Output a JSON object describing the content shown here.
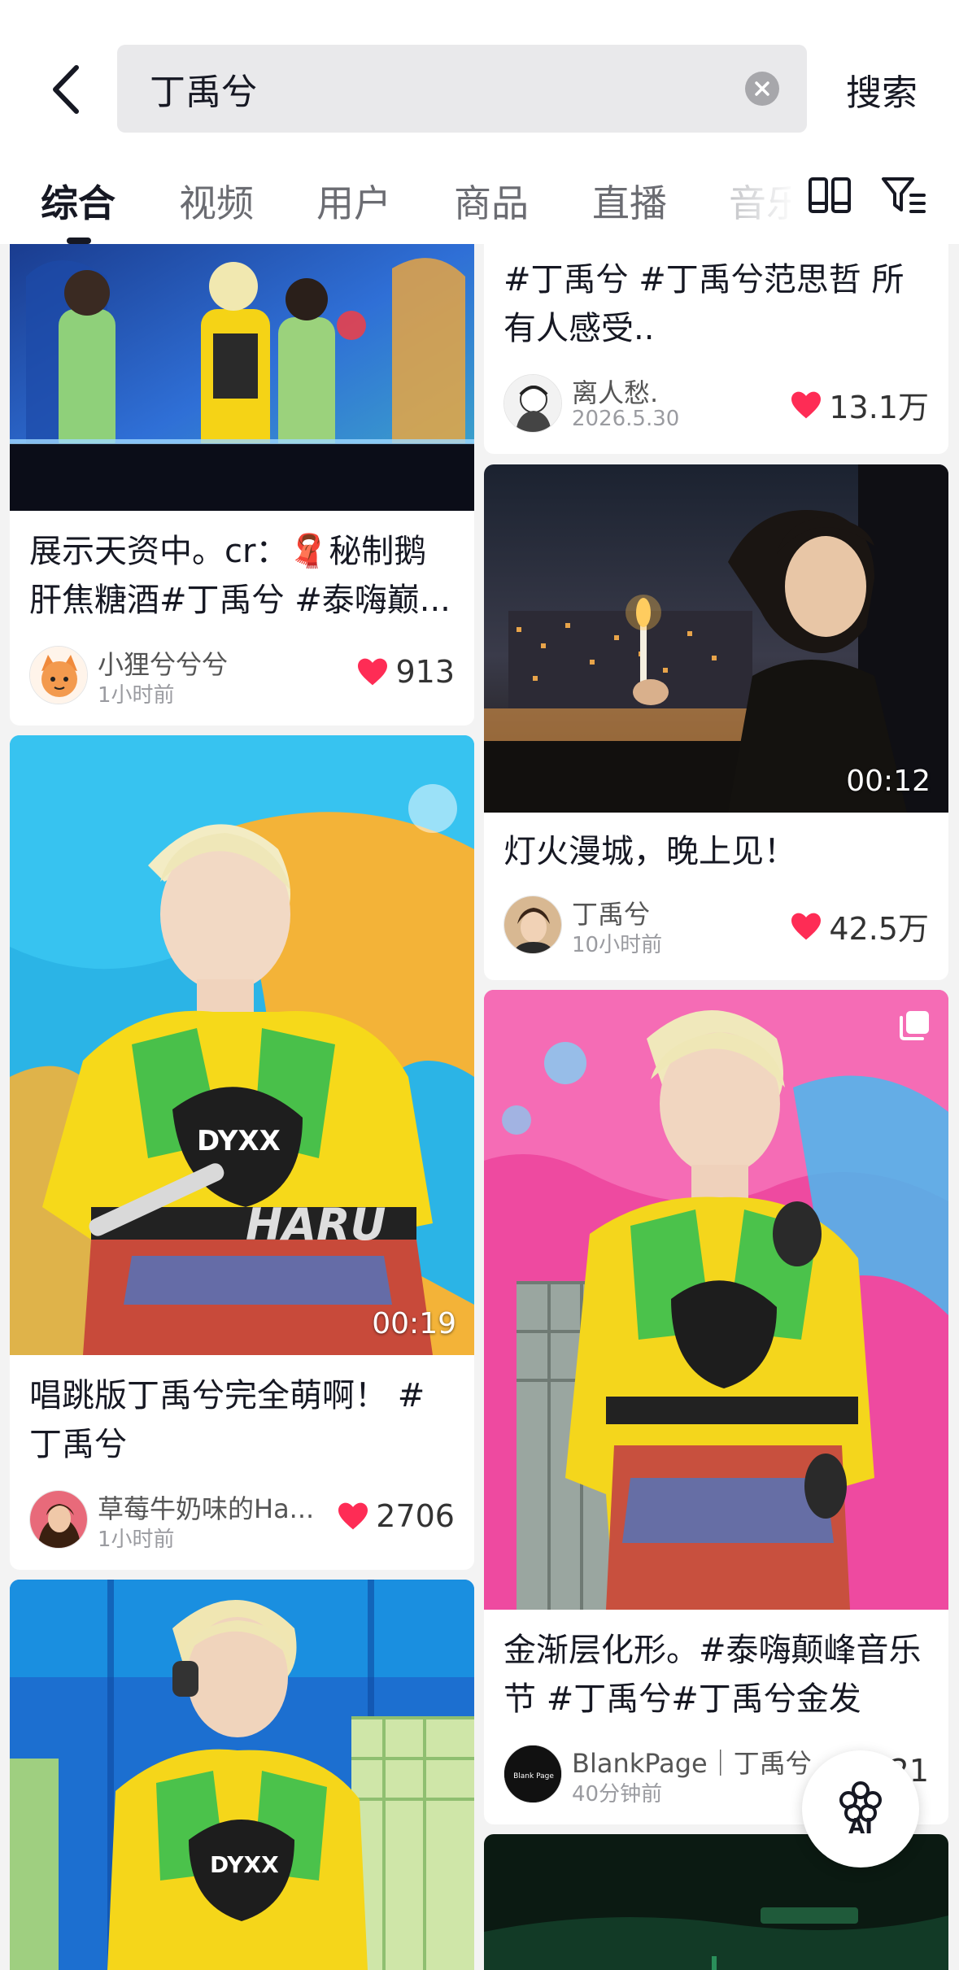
{
  "search": {
    "query": "丁禹兮",
    "button_label": "搜索"
  },
  "tabs": [
    {
      "label": "综合",
      "active": true
    },
    {
      "label": "视频",
      "active": false
    },
    {
      "label": "用户",
      "active": false
    },
    {
      "label": "商品",
      "active": false
    },
    {
      "label": "直播",
      "active": false
    },
    {
      "label": "音乐",
      "active": false
    }
  ],
  "icons": {
    "back": "chevron-left-icon",
    "clear": "clear-circle-icon",
    "layout": "double-column-layout-icon",
    "filter": "filter-icon",
    "like": "heart-icon",
    "gallery": "multi-image-icon",
    "ai": "ai-assistant-icon"
  },
  "colors": {
    "accent_red": "#fe2c55",
    "text_primary": "#161823",
    "search_bg": "#e9e9eb"
  },
  "feed": {
    "left": [
      {
        "caption": "展示天资中。cr：🧣秘制鹅肝焦糖酒#丁禹兮 #泰嗨巅...",
        "author": "小狸兮兮兮",
        "time": "1小时前",
        "likes": "913"
      },
      {
        "duration": "00:19",
        "watermark": "HARU",
        "caption": "唱跳版丁禹兮完全萌啊！ #丁禹兮",
        "author": "草莓牛奶味的Ha...",
        "time": "1小时前",
        "likes": "2706"
      },
      {
        "image_text": "DYXX"
      }
    ],
    "right": [
      {
        "caption": "#丁禹兮 #丁禹兮范思哲 所有人感受..",
        "author": "离人愁.",
        "time": "2026.5.30",
        "likes": "13.1万"
      },
      {
        "duration": "00:12",
        "caption": "灯火漫城，晚上见！",
        "author": "丁禹兮",
        "time": "10小时前",
        "likes": "42.5万"
      },
      {
        "caption": "金渐层化形。#泰嗨颠峰音乐节 #丁禹兮#丁禹兮金发",
        "author": "BlankPage｜丁禹兮",
        "time": "40分钟前",
        "likes": "121",
        "avatar_text": "Blank Page"
      },
      {}
    ]
  },
  "ai_button": {
    "label": "AI"
  }
}
